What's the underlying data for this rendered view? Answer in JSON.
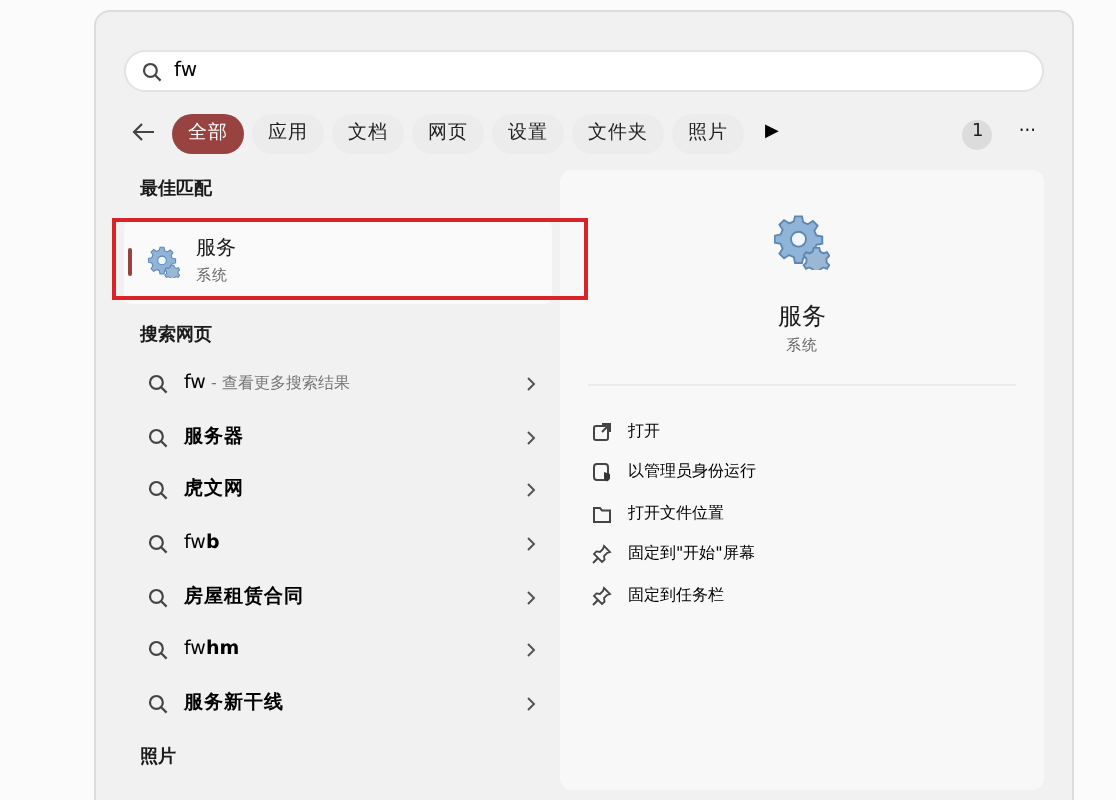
{
  "search": {
    "value": "fw"
  },
  "filters": [
    {
      "label": "全部",
      "selected": true
    },
    {
      "label": "应用",
      "selected": false
    },
    {
      "label": "文档",
      "selected": false
    },
    {
      "label": "网页",
      "selected": false
    },
    {
      "label": "设置",
      "selected": false
    },
    {
      "label": "文件夹",
      "selected": false
    },
    {
      "label": "照片",
      "selected": false
    }
  ],
  "more_filters": "▶",
  "badge": "1",
  "menu": "···",
  "best_match": {
    "heading": "最佳匹配",
    "title": "服务",
    "subtitle": "系统",
    "selected": true,
    "highlighted": true
  },
  "web": {
    "heading": "搜索网页",
    "items": [
      {
        "text": "fw",
        "suffix": "- 查看更多搜索结果"
      },
      {
        "text": "**服务器**"
      },
      {
        "text": "**虎文网**"
      },
      {
        "text": "fw**b**"
      },
      {
        "text": "**房屋租赁合同**"
      },
      {
        "text": "fw**hm**"
      },
      {
        "text": "**服务新干线**"
      }
    ]
  },
  "photos": {
    "heading": "照片"
  },
  "detail": {
    "title": "服务",
    "subtitle": "系统",
    "actions": [
      {
        "kind": "open",
        "label": "打开"
      },
      {
        "kind": "admin",
        "label": "以管理员身份运行"
      },
      {
        "kind": "folder",
        "label": "打开文件位置"
      },
      {
        "kind": "pin",
        "label": "固定到\"开始\"屏幕"
      },
      {
        "kind": "pin",
        "label": "固定到任务栏"
      }
    ]
  }
}
